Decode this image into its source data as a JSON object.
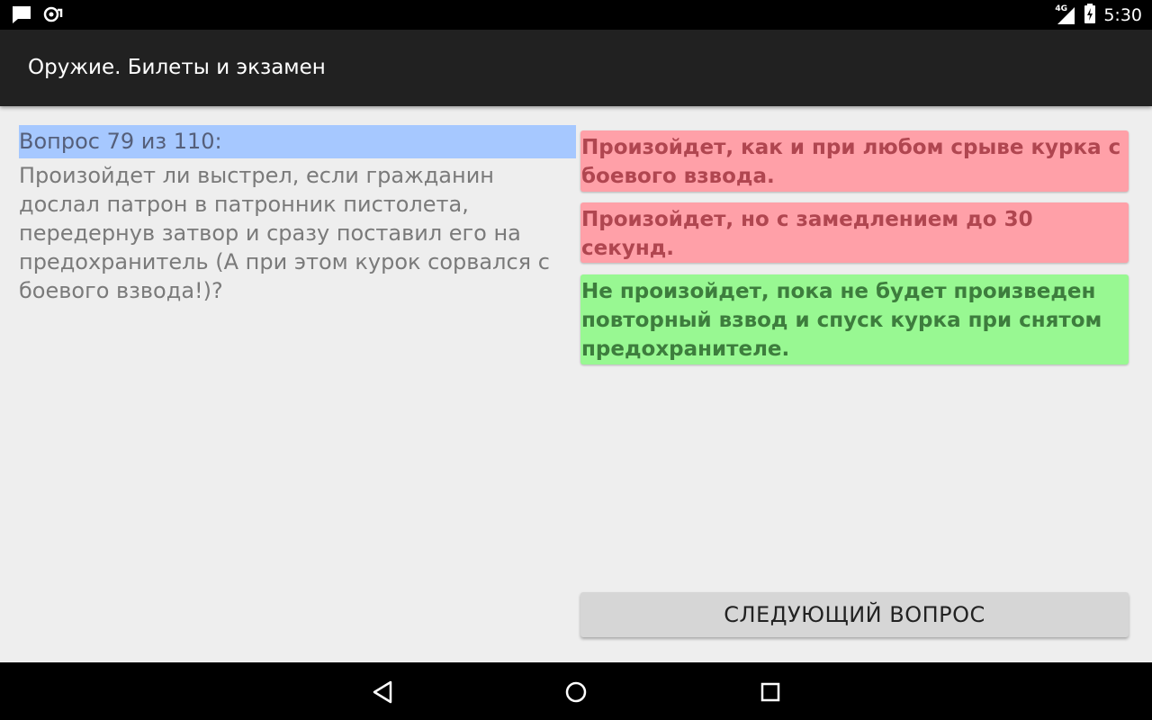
{
  "status_bar": {
    "time": "5:30",
    "network": "4G",
    "icons": [
      "message-icon",
      "notification-icon",
      "signal-icon",
      "battery-icon"
    ]
  },
  "app_bar": {
    "title": "Оружие. Билеты и экзамен"
  },
  "question": {
    "header": "Вопрос 79 из 110:",
    "text": "Произойдет ли выстрел, если гражданин дослал патрон в патронник пистолета, передернув затвор и сразу поставил его на предохранитель (А при этом курок сорвался с боевого взвода!)?"
  },
  "answers": [
    {
      "text": "Произойдет, как и при любом срыве курка с боевого взвода.",
      "status": "wrong"
    },
    {
      "text": "Произойдет, но с замедлением до 30 секунд.",
      "status": "wrong"
    },
    {
      "text": "Не произойдет, пока не будет произведен повторный взвод и спуск курка при снятом предохранителе.",
      "status": "correct"
    }
  ],
  "next_button": {
    "label": "СЛЕДУЮЩИЙ ВОПРОС"
  },
  "nav_bar": {
    "icons": [
      "back-icon",
      "home-icon",
      "recent-apps-icon"
    ]
  },
  "colors": {
    "question_highlight": "#a6c8ff",
    "wrong_answer": "#ffa0a8",
    "correct_answer": "#98f892",
    "app_bar": "#212121"
  }
}
